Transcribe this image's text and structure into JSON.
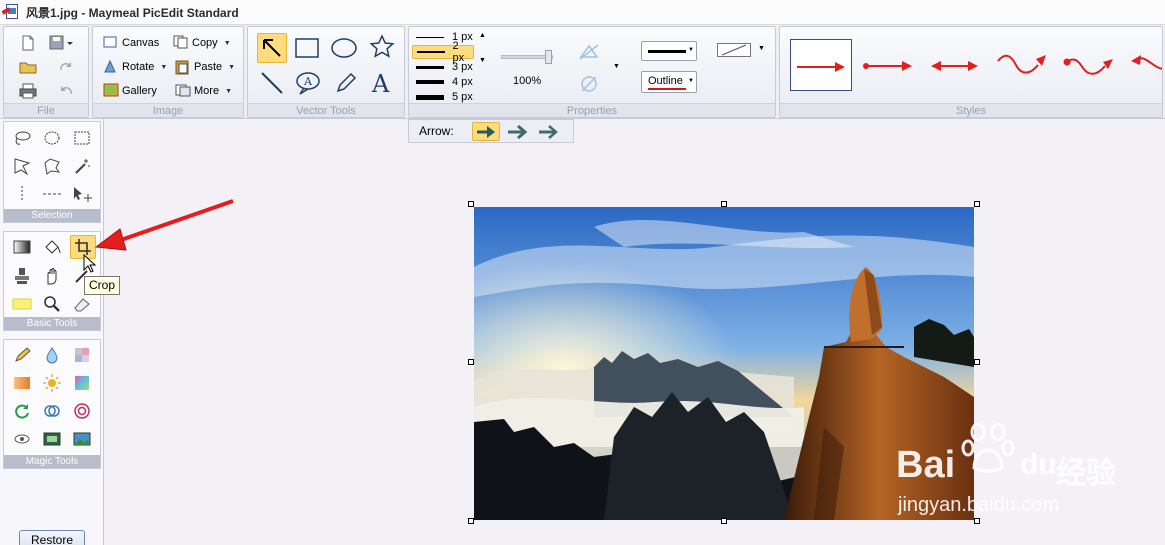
{
  "window": {
    "title": "风景1.jpg - Maymeal PicEdit Standard"
  },
  "ribbon": {
    "file": {
      "label": "File"
    },
    "image": {
      "label": "Image",
      "canvas_label": "Canvas",
      "copy_label": "Copy",
      "rotate_label": "Rotate",
      "paste_label": "Paste",
      "gallery_label": "Gallery",
      "more_label": "More"
    },
    "vector_tools": {
      "label": "Vector Tools"
    },
    "properties": {
      "label": "Properties",
      "line_widths": [
        "1 px",
        "2 px",
        "3 px",
        "4 px",
        "5 px"
      ],
      "selected_width": "2 px",
      "opacity_value": "100%",
      "outline_label": "Outline"
    },
    "styles": {
      "label": "Styles"
    }
  },
  "arrowbar": {
    "label": "Arrow:"
  },
  "left_panel": {
    "selection_label": "Selection",
    "basic_tools_label": "Basic Tools",
    "magic_tools_label": "Magic Tools",
    "restore_label": "Restore"
  },
  "tooltip": {
    "text": "Crop"
  },
  "watermark": {
    "brand": "Bai",
    "brand2": "du",
    "cn": "经验",
    "url": "jingyan.baidu.com"
  },
  "colors": {
    "accent": "#fcdc7c",
    "arrow_red": "#e41e1e",
    "panel_border": "#c7cbd8"
  }
}
